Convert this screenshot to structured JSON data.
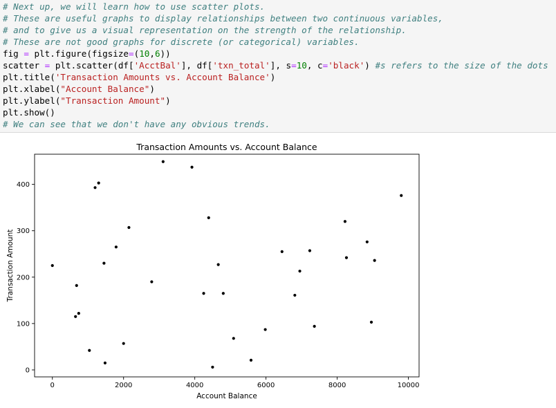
{
  "code_cell": {
    "lines": [
      [
        {
          "t": "# Next up, we will learn how to use scatter plots.",
          "c": "comment"
        }
      ],
      [
        {
          "t": "# These are useful graphs to display relationships between two continuous variables,",
          "c": "comment"
        }
      ],
      [
        {
          "t": "# and to give us a visual representation on the strength of the relationship.",
          "c": "comment"
        }
      ],
      [
        {
          "t": "# These are not good graphs for discrete (or categorical) variables.",
          "c": "comment"
        }
      ],
      [
        {
          "t": "fig ",
          "c": "plain"
        },
        {
          "t": "=",
          "c": "op"
        },
        {
          "t": " plt.figure(figsize",
          "c": "plain"
        },
        {
          "t": "=",
          "c": "op"
        },
        {
          "t": "(",
          "c": "plain"
        },
        {
          "t": "10",
          "c": "number"
        },
        {
          "t": ",",
          "c": "plain"
        },
        {
          "t": "6",
          "c": "number"
        },
        {
          "t": "))",
          "c": "plain"
        }
      ],
      [
        {
          "t": "scatter ",
          "c": "plain"
        },
        {
          "t": "=",
          "c": "op"
        },
        {
          "t": " plt.scatter(df[",
          "c": "plain"
        },
        {
          "t": "'AcctBal'",
          "c": "string"
        },
        {
          "t": "], df[",
          "c": "plain"
        },
        {
          "t": "'txn_total'",
          "c": "string"
        },
        {
          "t": "], s",
          "c": "plain"
        },
        {
          "t": "=",
          "c": "op"
        },
        {
          "t": "10",
          "c": "number"
        },
        {
          "t": ", c",
          "c": "plain"
        },
        {
          "t": "=",
          "c": "op"
        },
        {
          "t": "'black'",
          "c": "string"
        },
        {
          "t": ") ",
          "c": "plain"
        },
        {
          "t": "#s refers to the size of the dots",
          "c": "comment"
        }
      ],
      [
        {
          "t": "plt.title(",
          "c": "plain"
        },
        {
          "t": "'Transaction Amounts vs. Account Balance'",
          "c": "string"
        },
        {
          "t": ")",
          "c": "plain"
        }
      ],
      [
        {
          "t": "plt.xlabel(",
          "c": "plain"
        },
        {
          "t": "\"Account Balance\"",
          "c": "string"
        },
        {
          "t": ")",
          "c": "plain"
        }
      ],
      [
        {
          "t": "plt.ylabel(",
          "c": "plain"
        },
        {
          "t": "\"Transaction Amount\"",
          "c": "string"
        },
        {
          "t": ")",
          "c": "plain"
        }
      ],
      [
        {
          "t": "plt.show()",
          "c": "plain"
        }
      ],
      [
        {
          "t": "# We can see that we don't have any obvious trends.",
          "c": "comment"
        }
      ]
    ]
  },
  "colors": {
    "comment": "#408080",
    "string": "#ba2121",
    "number": "#008000",
    "operator": "#aa22ff",
    "marker": "#000000",
    "cell_background": "#f5f5f5"
  },
  "chart_data": {
    "type": "scatter",
    "title": "Transaction Amounts vs. Account Balance",
    "xlabel": "Account Balance",
    "ylabel": "Transaction Amount",
    "xlim": [
      -500,
      10300
    ],
    "ylim": [
      -15,
      465
    ],
    "xticks": [
      0,
      2000,
      4000,
      6000,
      8000,
      10000
    ],
    "yticks": [
      0,
      100,
      200,
      300,
      400
    ],
    "grid": false,
    "points": [
      {
        "x": 0,
        "y": 225
      },
      {
        "x": 650,
        "y": 115
      },
      {
        "x": 680,
        "y": 182
      },
      {
        "x": 740,
        "y": 122
      },
      {
        "x": 1040,
        "y": 42
      },
      {
        "x": 1200,
        "y": 393
      },
      {
        "x": 1300,
        "y": 403
      },
      {
        "x": 1450,
        "y": 230
      },
      {
        "x": 1480,
        "y": 15
      },
      {
        "x": 1790,
        "y": 265
      },
      {
        "x": 2000,
        "y": 57
      },
      {
        "x": 2150,
        "y": 307
      },
      {
        "x": 2790,
        "y": 190
      },
      {
        "x": 3110,
        "y": 449
      },
      {
        "x": 3920,
        "y": 437
      },
      {
        "x": 4250,
        "y": 165
      },
      {
        "x": 4390,
        "y": 328
      },
      {
        "x": 4500,
        "y": 6
      },
      {
        "x": 4660,
        "y": 227
      },
      {
        "x": 4800,
        "y": 165
      },
      {
        "x": 5090,
        "y": 68
      },
      {
        "x": 5580,
        "y": 21
      },
      {
        "x": 5980,
        "y": 87
      },
      {
        "x": 6450,
        "y": 255
      },
      {
        "x": 6810,
        "y": 161
      },
      {
        "x": 6950,
        "y": 213
      },
      {
        "x": 7230,
        "y": 257
      },
      {
        "x": 7360,
        "y": 94
      },
      {
        "x": 8220,
        "y": 320
      },
      {
        "x": 8260,
        "y": 242
      },
      {
        "x": 8840,
        "y": 276
      },
      {
        "x": 8960,
        "y": 103
      },
      {
        "x": 9050,
        "y": 236
      },
      {
        "x": 9800,
        "y": 376
      }
    ]
  }
}
